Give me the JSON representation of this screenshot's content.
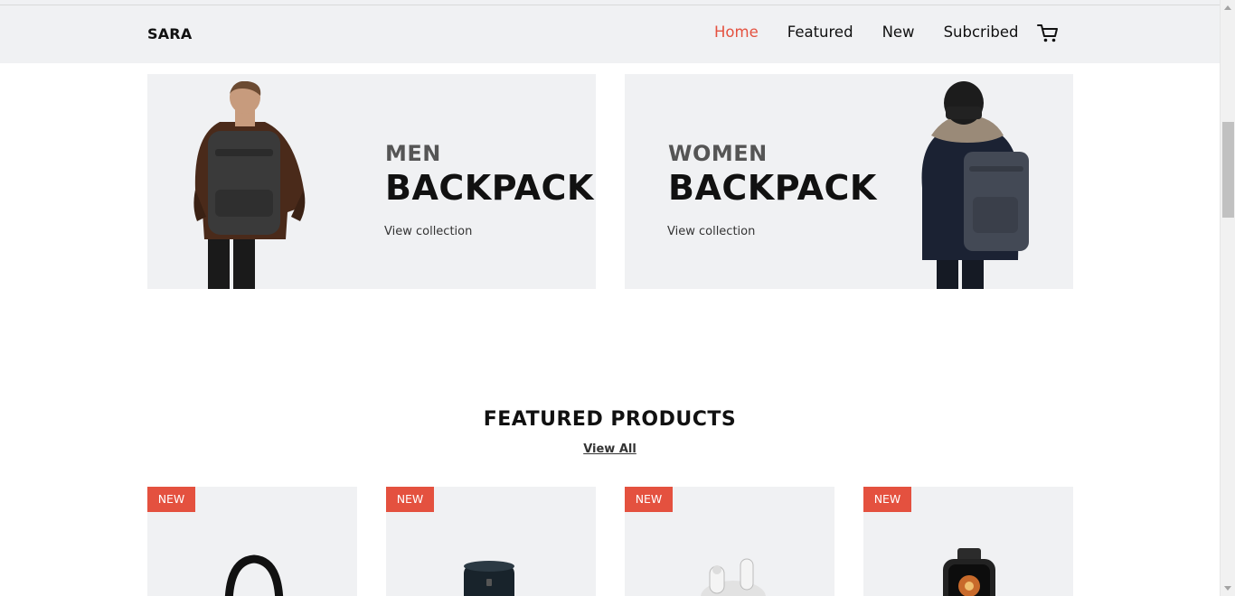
{
  "header": {
    "brand": "SARA",
    "nav": [
      "Home",
      "Featured",
      "New",
      "Subcribed"
    ],
    "active_nav": "Home",
    "cart_icon": "cart-icon",
    "accent_color": "#e4513f"
  },
  "banners": {
    "men": {
      "eyebrow": "MEN",
      "title": "BACKPACK",
      "link": "View collection"
    },
    "women": {
      "eyebrow": "WOMEN",
      "title": "BACKPACK",
      "link": "View collection"
    }
  },
  "featured": {
    "title": "FEATURED PRODUCTS",
    "view_all": "View All",
    "products": [
      {
        "badge": "NEW",
        "icon": "headphones-icon"
      },
      {
        "badge": "NEW",
        "icon": "speaker-icon"
      },
      {
        "badge": "NEW",
        "icon": "earbuds-icon"
      },
      {
        "badge": "NEW",
        "icon": "smartwatch-icon"
      }
    ]
  }
}
